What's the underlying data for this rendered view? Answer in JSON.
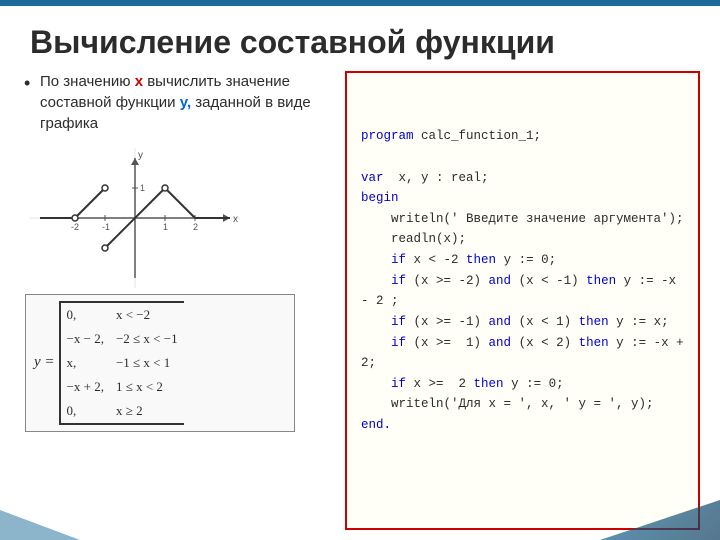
{
  "slide": {
    "title": "Вычисление составной функции",
    "top_bar_color": "#1a6b9a"
  },
  "left": {
    "bullet": "По значению x вычислить значение составной функции y, заданной в виде графика",
    "bullet_x": "x",
    "bullet_y": "y,"
  },
  "code": {
    "lines": [
      {
        "type": "keyword",
        "text": "program ",
        "rest": "calc_function_1;"
      },
      {
        "type": "blank"
      },
      {
        "type": "mixed",
        "keyword": "var",
        "rest": "  x, y : real;"
      },
      {
        "type": "keyword",
        "text": "begin"
      },
      {
        "type": "indent1",
        "text": "writeln(' Введите значение аргумента');"
      },
      {
        "type": "indent1",
        "text": "readln(x);"
      },
      {
        "type": "indent1",
        "keyword_part": "if",
        "text": " x < -2 ",
        "keyword2": "then",
        "rest": " y := 0;"
      },
      {
        "type": "indent1",
        "keyword_part": "if",
        "text": " (x >= -2) ",
        "keyword2": "and",
        "rest": " (x < -1) ",
        "keyword3": "then",
        "rest2": " y := -x - 2 ;"
      },
      {
        "type": "indent1",
        "keyword_part": "if",
        "text": " (x >= -1) ",
        "keyword2": "and",
        "rest": " (x < 1) ",
        "keyword3": "then",
        "rest2": " y := x;"
      },
      {
        "type": "indent1",
        "keyword_part": "if",
        "text": " (x >=  1) ",
        "keyword2": "and",
        "rest": " (x < 2) ",
        "keyword3": "then",
        "rest2": " y := -x + 2;"
      },
      {
        "type": "indent1",
        "keyword_part": "if",
        "text": " x >=  2 ",
        "keyword2": "then",
        "rest": " y := 0;"
      },
      {
        "type": "indent1",
        "text": "writeln('Для х = ', x, ' y = ', y);"
      },
      {
        "type": "keyword",
        "text": "end."
      }
    ]
  },
  "formula": {
    "label": "y =",
    "cases": [
      {
        "expr": "0,",
        "condition": "x < −2"
      },
      {
        "expr": "−x − 2,",
        "condition": "−2 ≤ x < −1"
      },
      {
        "expr": "x,",
        "condition": "−1 ≤ x < 1"
      },
      {
        "expr": "−x + 2,",
        "condition": "1 ≤ x < 2"
      },
      {
        "expr": "0,",
        "condition": "x ≥ 2"
      }
    ]
  }
}
